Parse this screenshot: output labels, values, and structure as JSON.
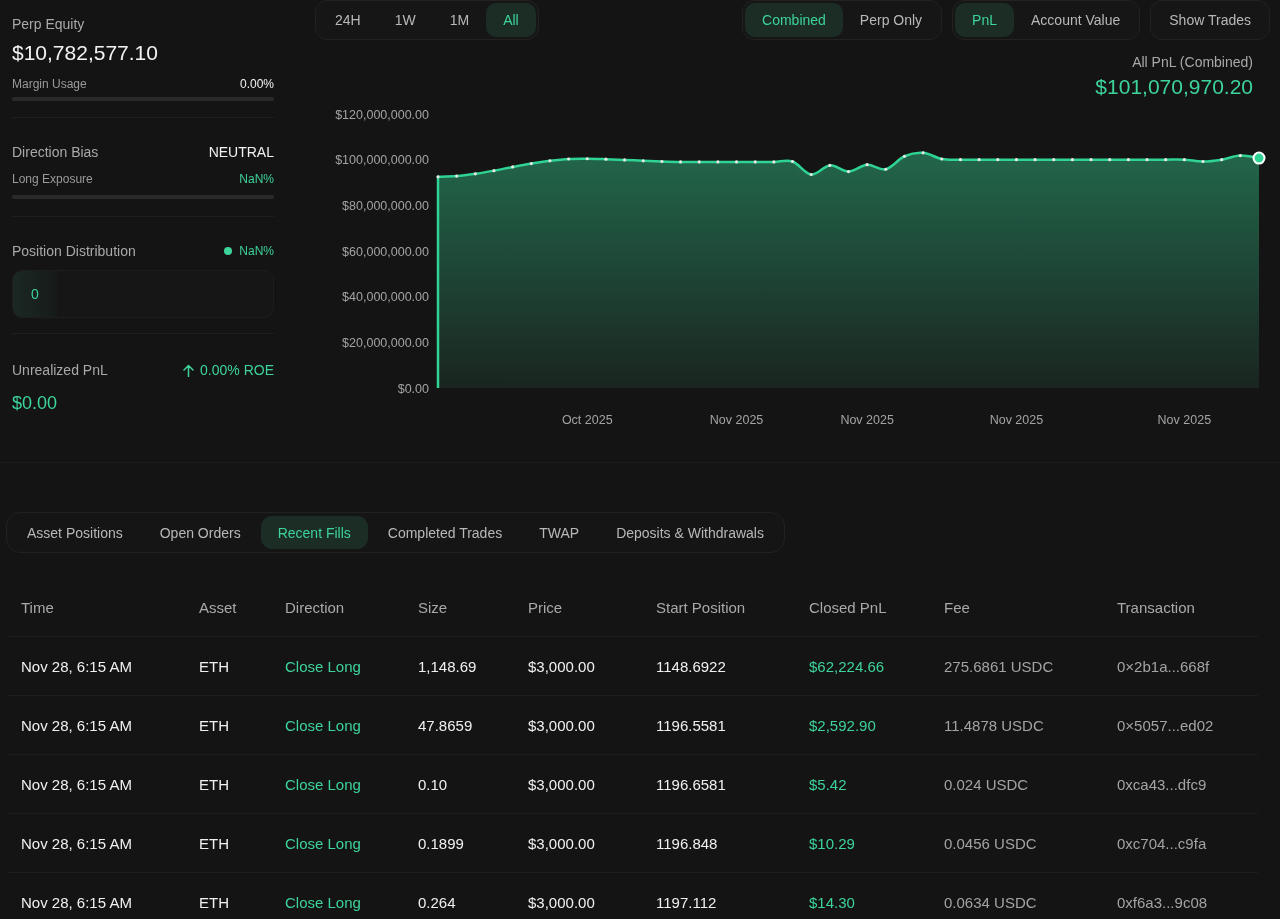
{
  "account_summary": {
    "perp_equity": {
      "label": "Perp Equity",
      "value": "$10,782,577.10"
    },
    "margin_usage": {
      "label": "Margin Usage",
      "value": "0.00%",
      "level": 0
    },
    "direction_bias": {
      "label": "Direction Bias",
      "value": "NEUTRAL"
    },
    "long_exposure": {
      "label": "Long Exposure",
      "value": "NaN%",
      "level": 0
    },
    "position_distribution": {
      "label": "Position Distribution",
      "legend_value": "NaN%",
      "segments": [
        {
          "label": "0"
        }
      ]
    },
    "unrealized_pnl": {
      "label": "Unrealized PnL",
      "roe": "0.00% ROE",
      "value": "$0.00"
    }
  },
  "range_tabs": [
    {
      "label": "24H",
      "selected": false
    },
    {
      "label": "1W",
      "selected": false
    },
    {
      "label": "1M",
      "selected": false
    },
    {
      "label": "All",
      "selected": true
    }
  ],
  "scope_tabs": [
    {
      "label": "Combined",
      "selected": true
    },
    {
      "label": "Perp Only",
      "selected": false
    }
  ],
  "metric_tabs": [
    {
      "label": "PnL",
      "selected": true
    },
    {
      "label": "Account Value",
      "selected": false
    }
  ],
  "show_trades_button": {
    "label": "Show Trades"
  },
  "pnl_chart": {
    "label": "All PnL (Combined)",
    "value": "$101,070,970.20",
    "chart_data": {
      "type": "area",
      "categories": [
        null,
        null,
        null,
        null,
        null,
        null,
        null,
        null,
        "Oct 2025",
        null,
        null,
        null,
        null,
        null,
        null,
        null,
        "Nov 2025",
        null,
        null,
        null,
        null,
        null,
        null,
        "Nov 2025",
        null,
        null,
        null,
        null,
        null,
        null,
        null,
        "Nov 2025",
        null,
        null,
        null,
        null,
        null,
        null,
        null,
        null,
        "Nov 2025",
        null,
        null,
        null,
        null
      ],
      "values": [
        92500000,
        92800000,
        93800000,
        95200000,
        96800000,
        98300000,
        99500000,
        100300000,
        100400000,
        100200000,
        99900000,
        99500000,
        99200000,
        99000000,
        99000000,
        99000000,
        99000000,
        99000000,
        99000000,
        99200000,
        93500000,
        97500000,
        94800000,
        97800000,
        95800000,
        101500000,
        103000000,
        100300000,
        100000000,
        100000000,
        100000000,
        100000000,
        100000000,
        100000000,
        100000000,
        100000000,
        100000000,
        100000000,
        100000000,
        100000000,
        100000000,
        99200000,
        100000000,
        101800000,
        100700000
      ],
      "ylim": [
        0,
        120000000
      ],
      "yticks": [
        {
          "value": 0,
          "label": "$0.00"
        },
        {
          "value": 20000000,
          "label": "$20,000,000.00"
        },
        {
          "value": 40000000,
          "label": "$40,000,000.00"
        },
        {
          "value": 60000000,
          "label": "$60,000,000.00"
        },
        {
          "value": 80000000,
          "label": "$80,000,000.00"
        },
        {
          "value": 100000000,
          "label": "$100,000,000.00"
        },
        {
          "value": 120000000,
          "label": "$120,000,000.00"
        }
      ]
    }
  },
  "bottom_tabs": [
    {
      "label": "Asset Positions",
      "selected": false
    },
    {
      "label": "Open Orders",
      "selected": false
    },
    {
      "label": "Recent Fills",
      "selected": true
    },
    {
      "label": "Completed Trades",
      "selected": false
    },
    {
      "label": "TWAP",
      "selected": false
    },
    {
      "label": "Deposits & Withdrawals",
      "selected": false
    }
  ],
  "fills_table": {
    "columns": [
      {
        "label": "Time",
        "kind": "text"
      },
      {
        "label": "Asset",
        "kind": "text"
      },
      {
        "label": "Direction",
        "kind": "positive"
      },
      {
        "label": "Size",
        "kind": "text"
      },
      {
        "label": "Price",
        "kind": "text"
      },
      {
        "label": "Start Position",
        "kind": "text"
      },
      {
        "label": "Closed PnL",
        "kind": "positive"
      },
      {
        "label": "Fee",
        "kind": "muted"
      },
      {
        "label": "Transaction",
        "kind": "muted"
      }
    ],
    "rows": [
      [
        "Nov 28, 6:15 AM",
        "ETH",
        "Close Long",
        "1,148.69",
        "$3,000.00",
        "1148.6922",
        "$62,224.66",
        "275.6861 USDC",
        "0×2b1a...668f"
      ],
      [
        "Nov 28, 6:15 AM",
        "ETH",
        "Close Long",
        "47.8659",
        "$3,000.00",
        "1196.5581",
        "$2,592.90",
        "11.4878 USDC",
        "0×5057...ed02"
      ],
      [
        "Nov 28, 6:15 AM",
        "ETH",
        "Close Long",
        "0.10",
        "$3,000.00",
        "1196.6581",
        "$5.42",
        "0.024 USDC",
        "0xca43...dfc9"
      ],
      [
        "Nov 28, 6:15 AM",
        "ETH",
        "Close Long",
        "0.1899",
        "$3,000.00",
        "1196.848",
        "$10.29",
        "0.0456 USDC",
        "0xc704...c9fa"
      ],
      [
        "Nov 28, 6:15 AM",
        "ETH",
        "Close Long",
        "0.264",
        "$3,000.00",
        "1197.112",
        "$14.30",
        "0.0634 USDC",
        "0xf6a3...9c08"
      ]
    ]
  }
}
